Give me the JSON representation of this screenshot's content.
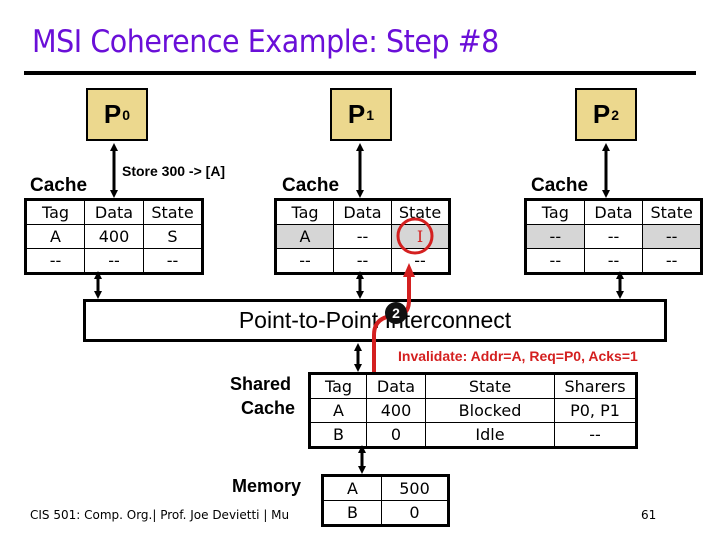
{
  "title": "MSI Coherence Example: Step #8",
  "processors": [
    {
      "label": "P",
      "sub": "0"
    },
    {
      "label": "P",
      "sub": "1"
    },
    {
      "label": "P",
      "sub": "2"
    }
  ],
  "store_label": "Store 300 -> [A]",
  "cache_label": "Cache",
  "cache_headers": [
    "Tag",
    "Data",
    "State"
  ],
  "caches": [
    {
      "rows": [
        [
          "A",
          "400",
          "S"
        ],
        [
          "--",
          "--",
          "--"
        ]
      ]
    },
    {
      "rows": [
        [
          "A",
          "--",
          "I"
        ],
        [
          "--",
          "--",
          "--"
        ]
      ]
    },
    {
      "rows": [
        [
          "--",
          "--",
          "--"
        ],
        [
          "--",
          "--",
          "--"
        ]
      ]
    }
  ],
  "interconnect_label": "Point-to-Point Interconnect",
  "step_badge": "2",
  "message": "Invalidate: Addr=A, Req=P0, Acks=1",
  "shared_cache": {
    "label_line1": "Shared",
    "label_line2": "Cache",
    "headers": [
      "Tag",
      "Data",
      "State",
      "Sharers"
    ],
    "rows": [
      [
        "A",
        "400",
        "Blocked",
        "P0, P1"
      ],
      [
        "B",
        "0",
        "Idle",
        "--"
      ]
    ]
  },
  "memory": {
    "label": "Memory",
    "rows": [
      [
        "A",
        "500"
      ],
      [
        "B",
        "0"
      ]
    ]
  },
  "footer": "CIS 501: Comp. Org.| Prof. Joe Devietti | Mu",
  "page_number": "61",
  "colors": {
    "title": "#6a0fd8",
    "processor_fill": "#ecd88e",
    "highlight": "#d6d6d6",
    "alert": "#d42020"
  }
}
